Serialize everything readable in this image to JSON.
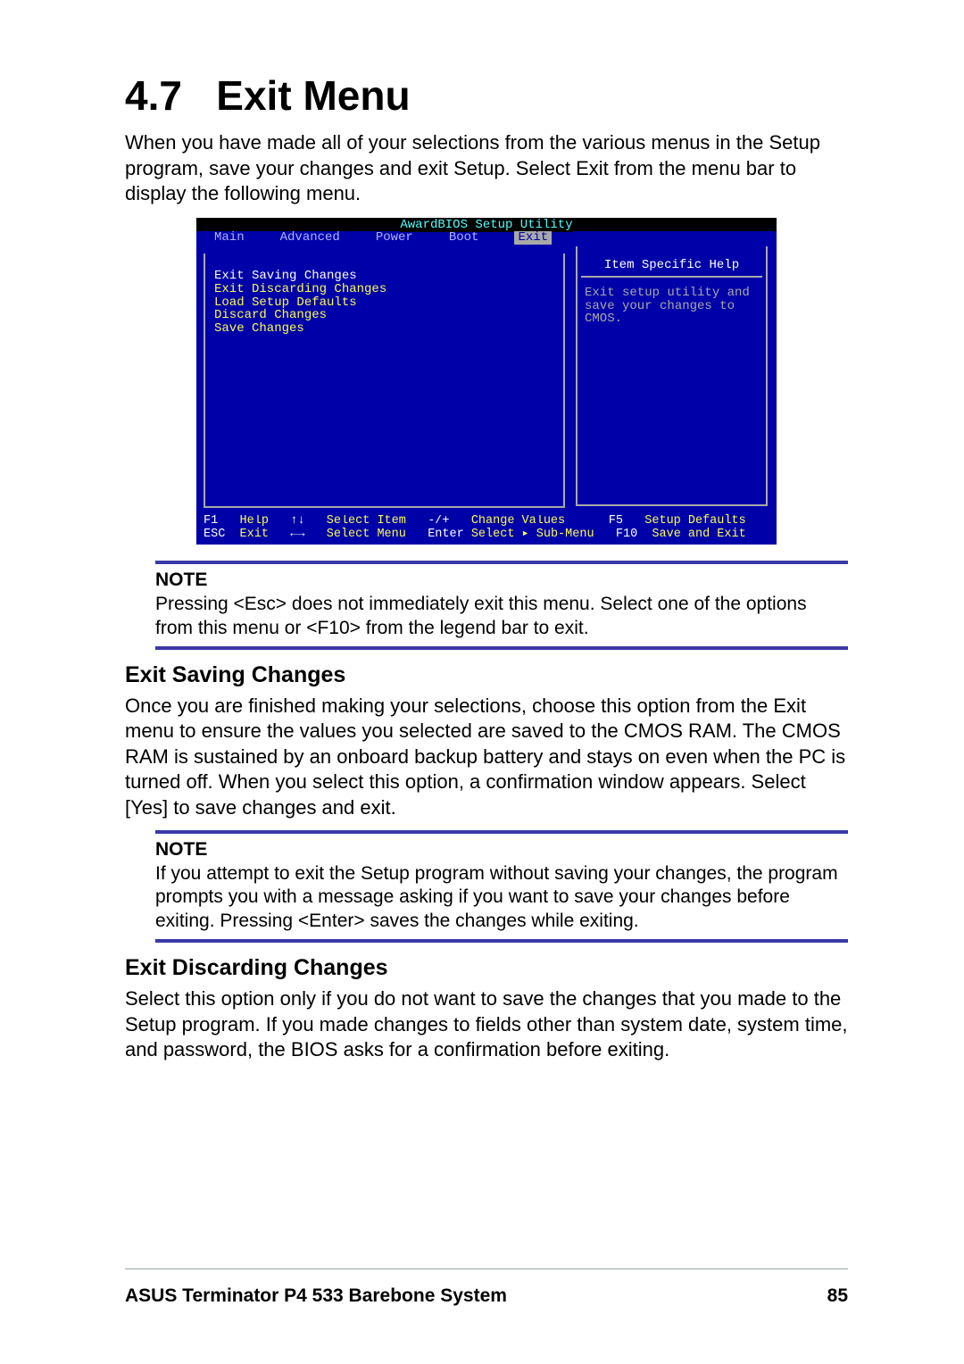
{
  "heading": {
    "number": "4.7",
    "title": "Exit Menu"
  },
  "intro_paragraph": "When you have made all of your selections from the various menus in the Setup program, save your changes and exit Setup. Select Exit from the menu bar to display the following menu.",
  "bios": {
    "utility_title": "AwardBIOS Setup Utility",
    "tabs": [
      "Main",
      "Advanced",
      "Power",
      "Boot",
      "Exit"
    ],
    "selected_tab": "Exit",
    "exit_items": [
      "Exit Saving Changes",
      "Exit Discarding Changes",
      "Load Setup Defaults",
      "Discard Changes",
      "Save Changes"
    ],
    "help_panel_title": "Item Specific Help",
    "help_text": "Exit setup utility and save your changes to CMOS.",
    "footer_line1_keys": "F1",
    "footer_line1_a": "Help",
    "footer_line1_arrows1": "↑↓",
    "footer_line1_b": "Select Item",
    "footer_line1_pm": "-/+",
    "footer_line1_c": "Change Values",
    "footer_line1_f5": "F5",
    "footer_line1_d": "Setup Defaults",
    "footer_line2_keys": "ESC",
    "footer_line2_a": "Exit",
    "footer_line2_arrows2": "←→",
    "footer_line2_b": "Select Menu",
    "footer_line2_enter": "Enter",
    "footer_line2_c": "Select ▸ Sub-Menu",
    "footer_line2_f10": "F10",
    "footer_line2_d": "Save and Exit"
  },
  "note1": {
    "label": "NOTE",
    "text": "Pressing <Esc> does not immediately exit this menu. Select one of the options from this menu or <F10> from the legend bar to exit."
  },
  "sub1": {
    "heading": "Exit Saving Changes",
    "body": "Once you are finished making your selections, choose this option from the Exit menu to ensure the values you selected are saved to the CMOS RAM. The CMOS RAM is sustained by an onboard backup battery and stays on even when the PC is turned off. When you select this option, a confirmation window appears. Select [Yes] to save changes and exit."
  },
  "note2": {
    "label": "NOTE",
    "text": "If you attempt to exit the Setup program without saving your changes, the program prompts you with a message asking if you want to save your changes before exiting. Pressing <Enter> saves the  changes while exiting."
  },
  "sub2": {
    "heading": "Exit Discarding Changes",
    "body": "Select this option only if you do not want to save the changes that you made to the Setup program. If you made changes to fields other than system date, system time, and password, the BIOS asks for a confirmation before exiting."
  },
  "footer": {
    "product": "ASUS Terminator P4 533 Barebone System",
    "page": "85"
  }
}
